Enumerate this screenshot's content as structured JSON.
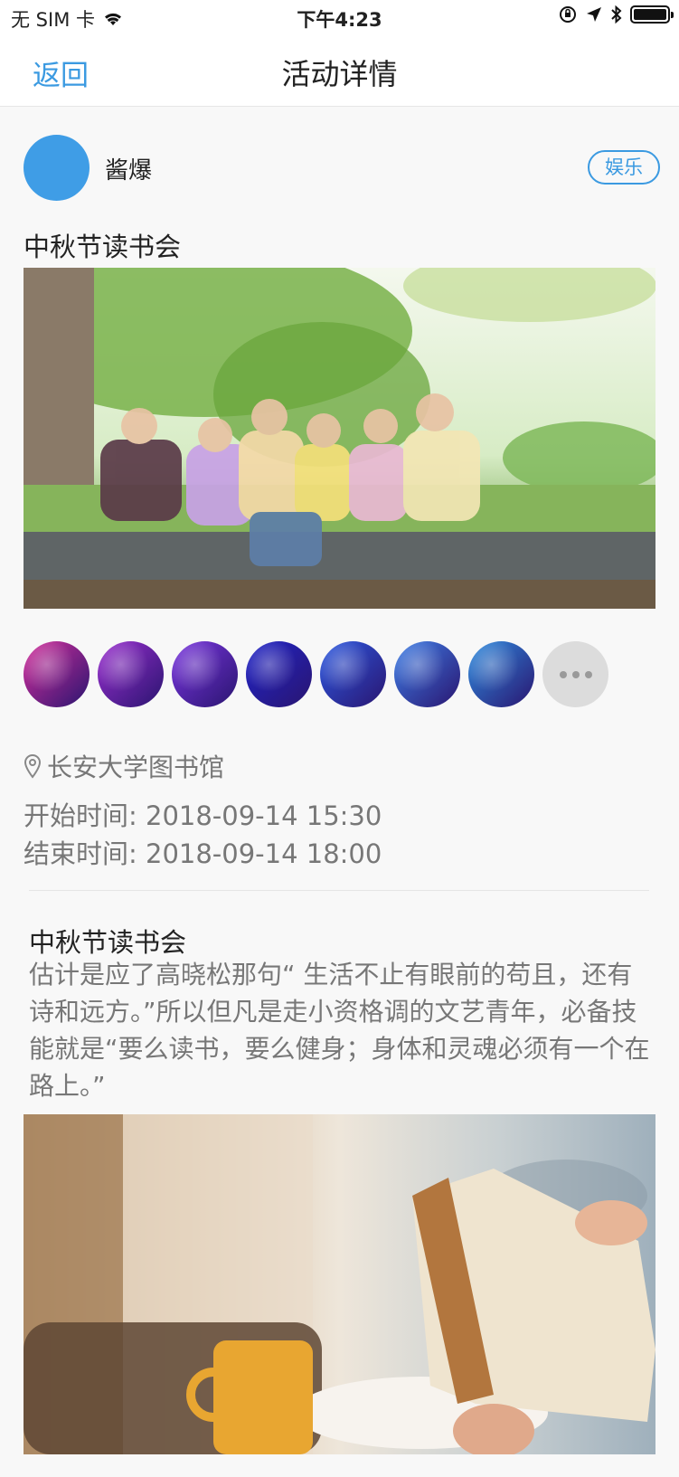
{
  "status_bar": {
    "carrier": "无 SIM 卡",
    "time": "下午4:23"
  },
  "nav": {
    "back_label": "返回",
    "title": "活动详情"
  },
  "publisher": {
    "name": "酱爆",
    "category": "娱乐"
  },
  "event": {
    "title": "中秋节读书会",
    "location": "长安大学图书馆",
    "start_time_label": "开始时间:",
    "start_time": "2018-09-14 15:30",
    "end_time_label": "结束时间:",
    "end_time": "2018-09-14 18:00"
  },
  "participants": {
    "colors": [
      "#d62f9c",
      "#9b2fd0",
      "#7b36e0",
      "#2024c8",
      "#2d5ae2",
      "#3f80e8",
      "#2f8de0"
    ]
  },
  "description": {
    "title": "中秋节读书会",
    "body": "估计是应了高晓松那句“ 生活不止有眼前的苟且，还有诗和远方。”所以但凡是走小资格调的文艺青年，必备技能就是“要么读书，要么健身；身体和灵魂必须有一个在路上。”"
  },
  "colors": {
    "accent": "#3b9ae1",
    "avatar": "#3f9de6",
    "secondary_text": "#777777"
  }
}
